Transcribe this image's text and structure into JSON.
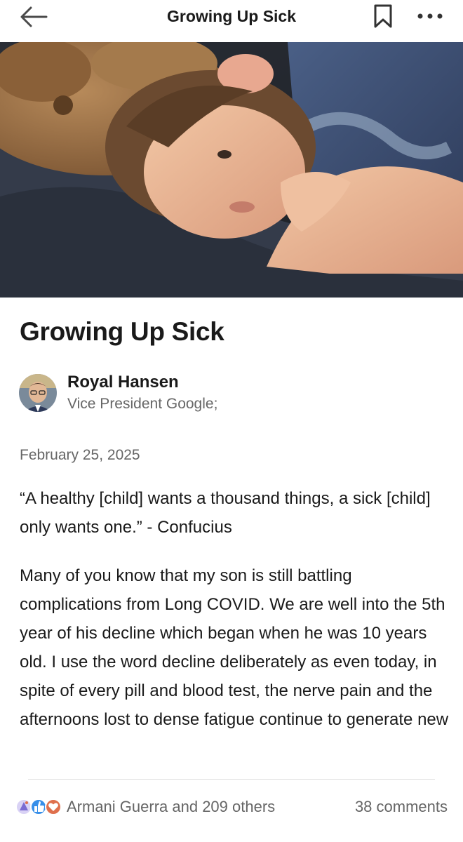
{
  "header": {
    "title": "Growing Up Sick",
    "back_icon": "arrow-left-icon",
    "bookmark_icon": "bookmark-icon",
    "more_icon": "more-horizontal-icon"
  },
  "article": {
    "title": "Growing Up Sick",
    "date": "February 25, 2025",
    "quote": "“A healthy [child] wants a thousand things, a sick [child] only wants one.” - Confucius",
    "paragraph": "Many of you know that my son is still battling complications from Long COVID. We are well into the 5th year of his decline which began when he was 10 years old. I use the word decline deliberately as even today, in spite of every pill and blood test, the nerve pain and the afternoons lost to dense fatigue continue to generate new"
  },
  "author": {
    "name": "Royal Hansen",
    "headline": "Vice President Google;"
  },
  "footer": {
    "reactions_text": "Armani Guerra and 209 others",
    "comments_text": "38 comments",
    "reaction_icons": [
      "celebrate-icon",
      "like-icon",
      "love-icon"
    ]
  },
  "colors": {
    "text_primary": "#1a1a1a",
    "text_secondary": "#666666",
    "divider": "#dcdcdc",
    "like_blue": "#378fe9",
    "love_red": "#df704d",
    "celebrate_purple": "#7a6bd2"
  }
}
